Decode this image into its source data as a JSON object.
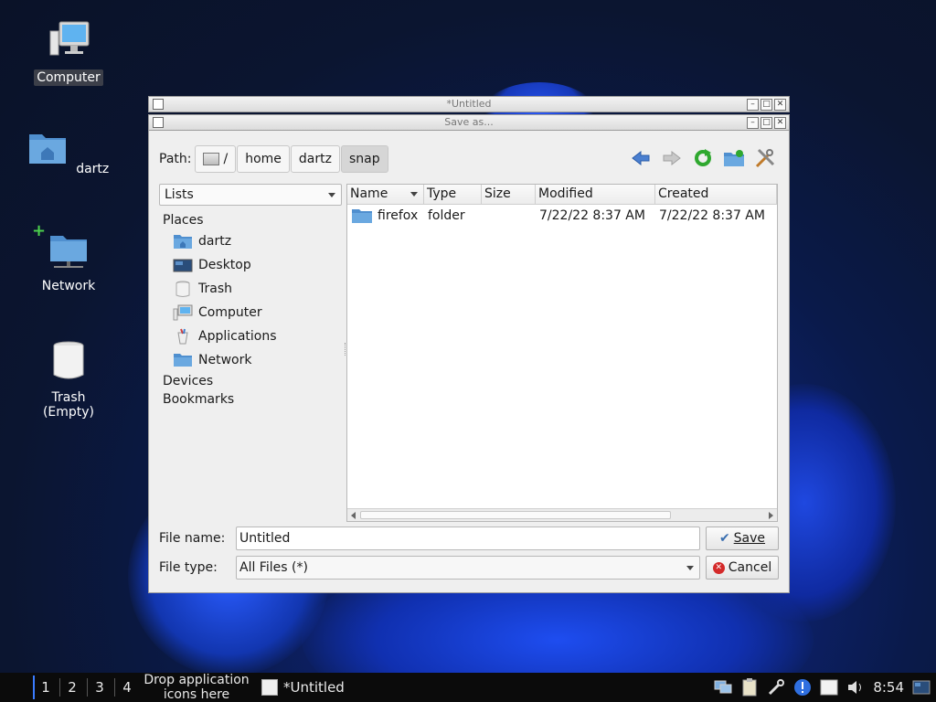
{
  "desktop": {
    "icons": [
      {
        "label": "Computer",
        "icon": "computer-icon"
      },
      {
        "label": "dartz",
        "icon": "home-folder-icon"
      },
      {
        "label": "Network",
        "icon": "network-folder-icon"
      },
      {
        "label": "Trash (Empty)",
        "icon": "trash-icon"
      }
    ]
  },
  "parent_window": {
    "title": "*Untitled"
  },
  "dialog": {
    "title": "Save as...",
    "path_label": "Path:",
    "path": [
      "/",
      "home",
      "dartz",
      "snap"
    ],
    "view_combo": "Lists",
    "places": {
      "header": "Places",
      "items": [
        {
          "label": "dartz",
          "icon": "home-folder-icon"
        },
        {
          "label": "Desktop",
          "icon": "desktop-icon"
        },
        {
          "label": "Trash",
          "icon": "trash-icon"
        },
        {
          "label": "Computer",
          "icon": "computer-icon"
        },
        {
          "label": "Applications",
          "icon": "applications-icon"
        },
        {
          "label": "Network",
          "icon": "network-folder-icon"
        }
      ],
      "devices": "Devices",
      "bookmarks": "Bookmarks"
    },
    "columns": [
      "Name",
      "Type",
      "Size",
      "Modified",
      "Created"
    ],
    "rows": [
      {
        "name": "firefox",
        "type": "folder",
        "size": "",
        "modified": "7/22/22 8:37 AM",
        "created": "7/22/22 8:37 AM"
      }
    ],
    "file_name_label": "File name:",
    "file_name": "Untitled",
    "file_type_label": "File type:",
    "file_type": "All Files (*)",
    "save_label": "Save",
    "cancel_label": "Cancel"
  },
  "taskbar": {
    "workspaces": [
      "1",
      "2",
      "3",
      "4"
    ],
    "launcher_hint": "Drop application icons here",
    "task_title": "*Untitled",
    "clock": "8:54"
  },
  "colors": {
    "accent": "#3a7cff",
    "folder": "#5b9bd5",
    "desktop_bg": "#0a1a4a"
  }
}
